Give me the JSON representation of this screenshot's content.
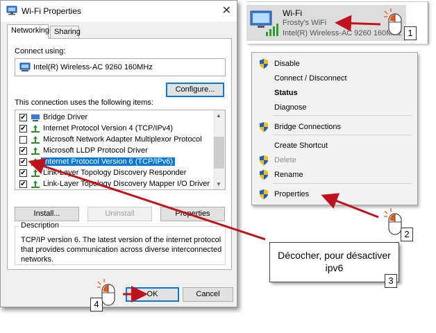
{
  "dialog": {
    "title": "Wi-Fi Properties",
    "close_glyph": "✕",
    "tabs": [
      {
        "label": "Networking",
        "active": true
      },
      {
        "label": "Sharing",
        "active": false
      }
    ],
    "connect_using_label": "Connect using:",
    "adapter_name": "Intel(R) Wireless-AC 9260 160MHz",
    "configure_button": "Configure...",
    "items_label": "This connection uses the following items:",
    "items": [
      {
        "label": "Bridge Driver",
        "checked": true,
        "selected": false,
        "icon": "network-adapter-icon"
      },
      {
        "label": "Internet Protocol Version 4 (TCP/IPv4)",
        "checked": true,
        "selected": false,
        "icon": "protocol-icon"
      },
      {
        "label": "Microsoft Network Adapter Multiplexor Protocol",
        "checked": false,
        "selected": false,
        "icon": "protocol-icon"
      },
      {
        "label": "Microsoft LLDP Protocol Driver",
        "checked": true,
        "selected": false,
        "icon": "protocol-icon"
      },
      {
        "label": "Internet Protocol Version 6 (TCP/IPv6)",
        "checked": true,
        "selected": true,
        "icon": "protocol-icon"
      },
      {
        "label": "Link-Layer Topology Discovery Responder",
        "checked": true,
        "selected": false,
        "icon": "protocol-icon"
      },
      {
        "label": "Link-Layer Topology Discovery Mapper I/O Driver",
        "checked": true,
        "selected": false,
        "icon": "protocol-icon"
      }
    ],
    "install_button": "Install...",
    "uninstall_button": "Uninstall",
    "properties_button": "Properties",
    "description_title": "Description",
    "description_text": "TCP/IP version 6. The latest version of the internet protocol that provides communication across diverse interconnected networks.",
    "ok_button": "OK",
    "cancel_button": "Cancel"
  },
  "wifi": {
    "name": "Wi-Fi",
    "network": "Frosty's WiFi",
    "adapter": "Intel(R) Wireless-AC 9260 160MHz"
  },
  "context_menu": {
    "items": [
      {
        "label": "Disable",
        "shield": true,
        "bold": false,
        "disabled": false
      },
      {
        "label": "Connect / Disconnect",
        "shield": false,
        "bold": false,
        "disabled": false
      },
      {
        "label": "Status",
        "shield": false,
        "bold": true,
        "disabled": false
      },
      {
        "label": "Diagnose",
        "shield": false,
        "bold": false,
        "disabled": false
      },
      {
        "label": "Bridge Connections",
        "shield": true,
        "bold": false,
        "disabled": false
      },
      {
        "label": "Create Shortcut",
        "shield": false,
        "bold": false,
        "disabled": false
      },
      {
        "label": "Delete",
        "shield": true,
        "bold": false,
        "disabled": true
      },
      {
        "label": "Rename",
        "shield": true,
        "bold": false,
        "disabled": false
      },
      {
        "label": "Properties",
        "shield": true,
        "bold": false,
        "disabled": false
      }
    ]
  },
  "annotation": {
    "callout_text": "Décocher, pour désactiver ipv6",
    "step_numbers": [
      "1",
      "2",
      "3",
      "4"
    ],
    "arrow_color": "#c0111f"
  },
  "colors": {
    "selection": "#0078d7",
    "shield_blue": "#1f5fbf",
    "shield_yellow": "#f4c20d"
  }
}
